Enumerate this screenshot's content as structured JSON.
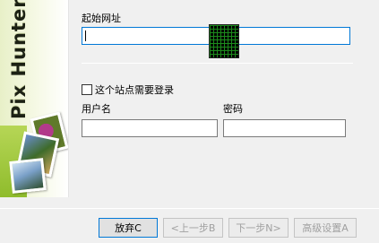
{
  "banner": {
    "title": "Pix Hunter"
  },
  "start_url": {
    "label": "起始网址",
    "value": ""
  },
  "login": {
    "checkbox_label": "这个站点需要登录",
    "checked": false,
    "username_label": "用户名",
    "username_value": "",
    "password_label": "密码",
    "password_value": ""
  },
  "buttons": {
    "cancel": "放弃C",
    "prev": "<上一步B",
    "next": "下一步N>",
    "advanced": "高级设置A"
  }
}
